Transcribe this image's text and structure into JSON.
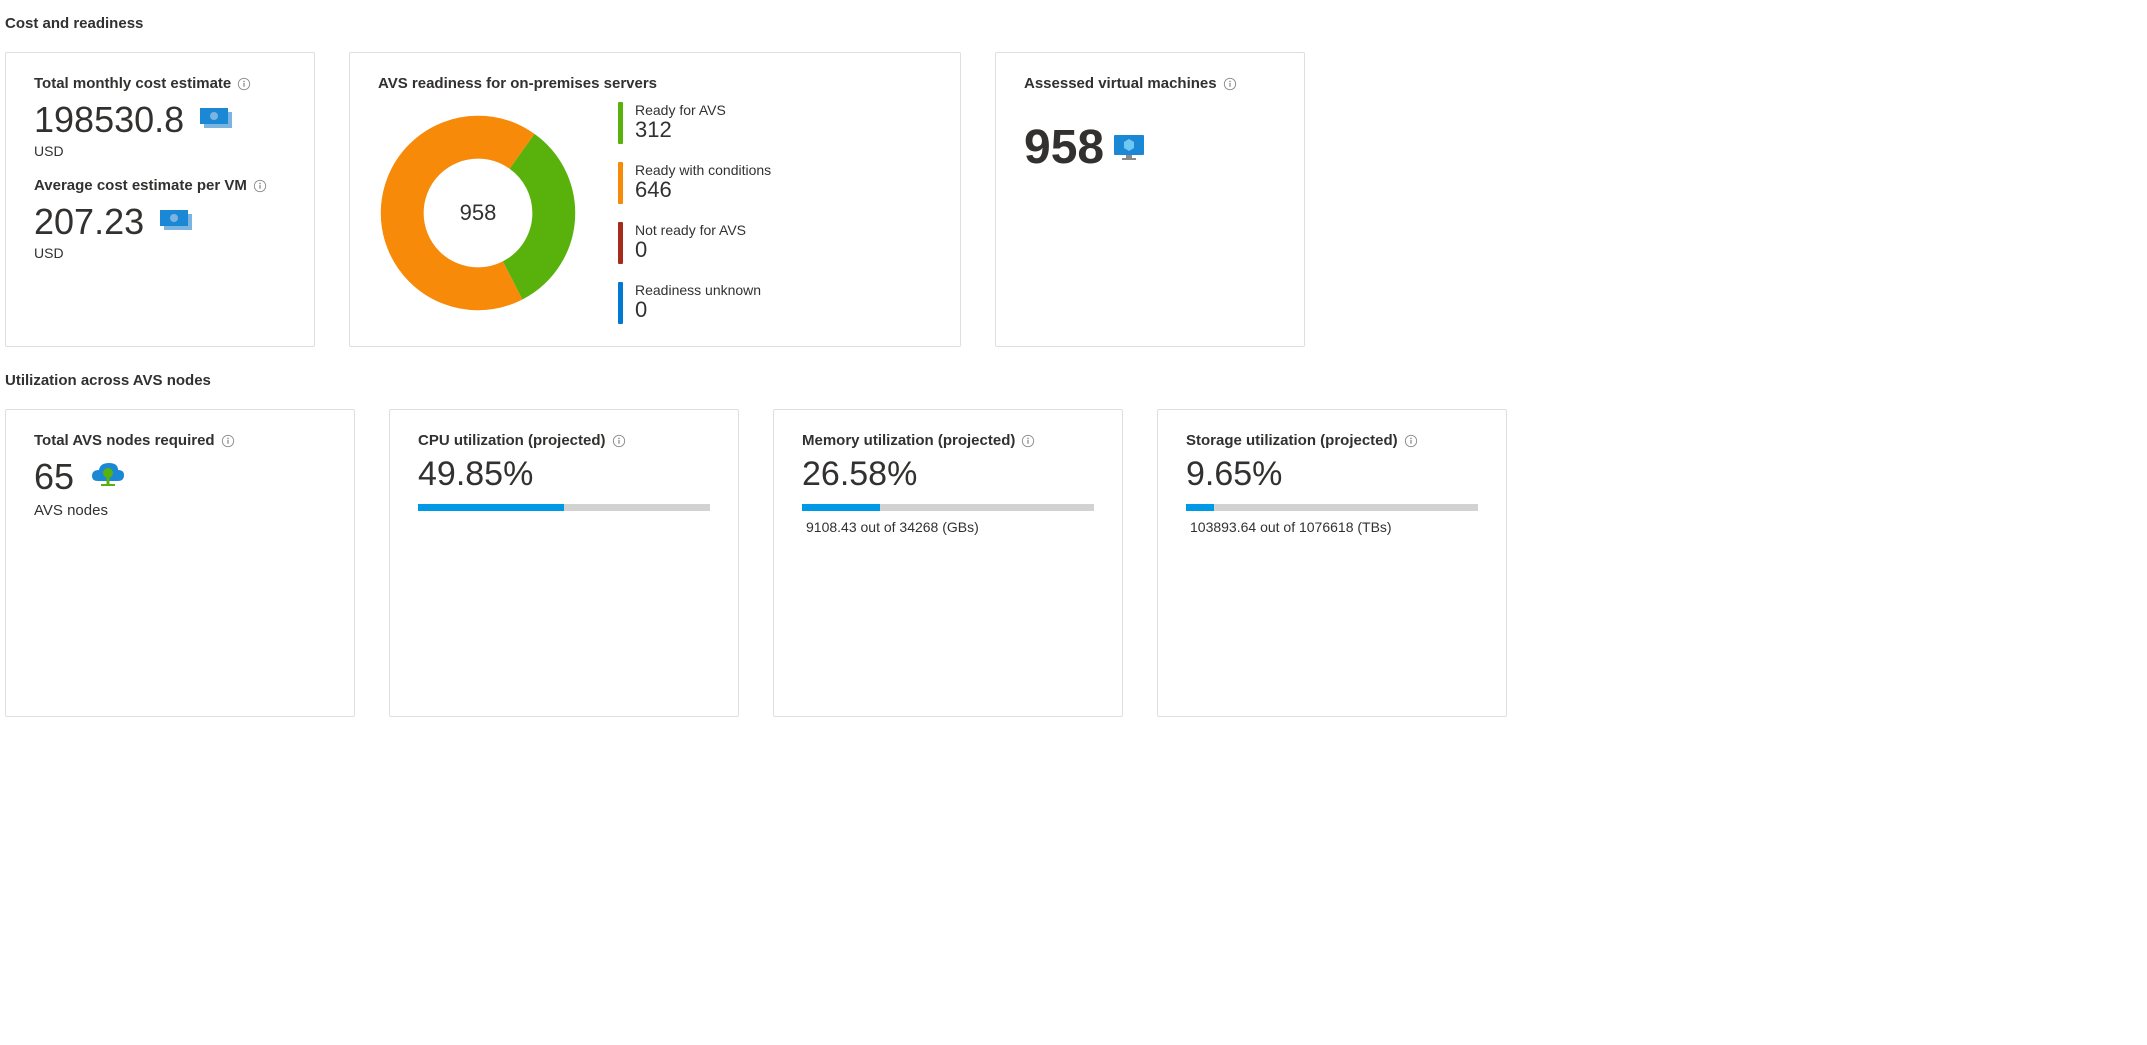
{
  "sections": {
    "cost_readiness_title": "Cost and readiness",
    "utilization_title": "Utilization across AVS nodes"
  },
  "cost_card": {
    "total_label": "Total monthly cost estimate",
    "total_value": "198530.8",
    "total_currency": "USD",
    "avg_label": "Average cost estimate per VM",
    "avg_value": "207.23",
    "avg_currency": "USD"
  },
  "readiness_card": {
    "title": "AVS readiness for on-premises servers",
    "center_value": "958",
    "items": [
      {
        "label": "Ready for AVS",
        "value": "312",
        "color": "#59b20c"
      },
      {
        "label": "Ready with conditions",
        "value": "646",
        "color": "#f78a09"
      },
      {
        "label": "Not ready for AVS",
        "value": "0",
        "color": "#a72b1b"
      },
      {
        "label": "Readiness unknown",
        "value": "0",
        "color": "#0078d4"
      }
    ]
  },
  "assessed_card": {
    "label": "Assessed virtual machines",
    "value": "958"
  },
  "nodes_card": {
    "label": "Total AVS nodes required",
    "value": "65",
    "sub": "AVS nodes"
  },
  "cpu_card": {
    "label": "CPU utilization (projected)",
    "percent": "49.85%",
    "fill": 49.85
  },
  "mem_card": {
    "label": "Memory utilization (projected)",
    "percent": "26.58%",
    "fill": 26.58,
    "detail": "9108.43 out of 34268 (GBs)"
  },
  "storage_card": {
    "label": "Storage utilization (projected)",
    "percent": "9.65%",
    "fill": 9.65,
    "detail": "103893.64 out of 1076618 (TBs)"
  },
  "chart_data": {
    "type": "pie",
    "title": "AVS readiness for on-premises servers",
    "categories": [
      "Ready for AVS",
      "Ready with conditions",
      "Not ready for AVS",
      "Readiness unknown"
    ],
    "values": [
      312,
      646,
      0,
      0
    ],
    "total": 958
  }
}
